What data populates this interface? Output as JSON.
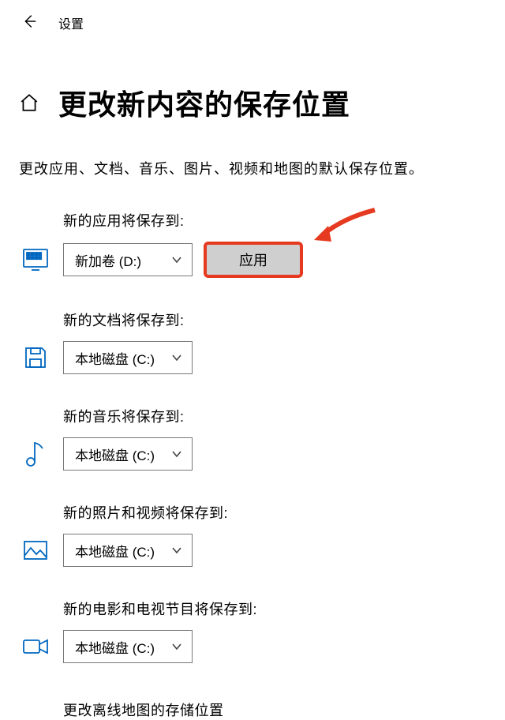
{
  "header": {
    "title": "设置"
  },
  "page": {
    "title": "更改新内容的保存位置",
    "description": "更改应用、文档、音乐、图片、视频和地图的默认保存位置。"
  },
  "sections": {
    "apps": {
      "label": "新的应用将保存到:",
      "value": "新加卷 (D:)",
      "apply": "应用"
    },
    "docs": {
      "label": "新的文档将保存到:",
      "value": "本地磁盘 (C:)"
    },
    "music": {
      "label": "新的音乐将保存到:",
      "value": "本地磁盘 (C:)"
    },
    "photos": {
      "label": "新的照片和视频将保存到:",
      "value": "本地磁盘 (C:)"
    },
    "movies": {
      "label": "新的电影和电视节目将保存到:",
      "value": "本地磁盘 (C:)"
    }
  },
  "footer": {
    "maps_label": "更改离线地图的存储位置"
  },
  "colors": {
    "accent": "#0067c0",
    "highlight_border": "#e53a1f",
    "arrow": "#e53a1f"
  }
}
